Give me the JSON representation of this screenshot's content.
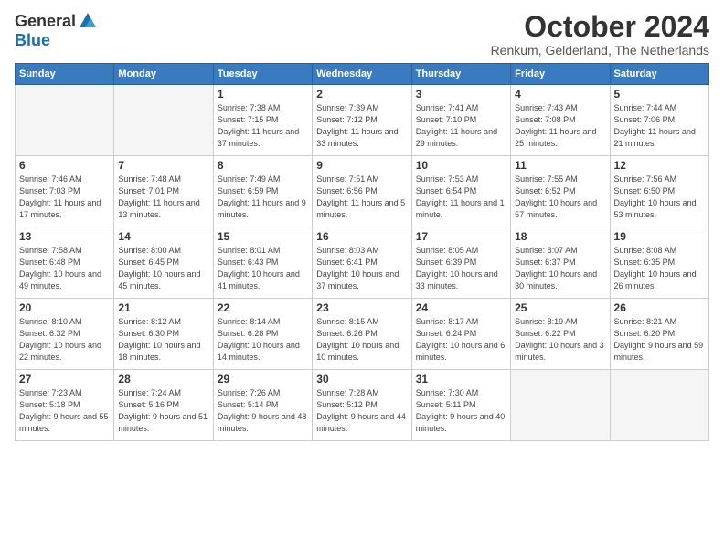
{
  "logo": {
    "general": "General",
    "blue": "Blue"
  },
  "title": "October 2024",
  "location": "Renkum, Gelderland, The Netherlands",
  "days_of_week": [
    "Sunday",
    "Monday",
    "Tuesday",
    "Wednesday",
    "Thursday",
    "Friday",
    "Saturday"
  ],
  "weeks": [
    [
      {
        "day": "",
        "empty": true
      },
      {
        "day": "",
        "empty": true
      },
      {
        "day": "1",
        "sunrise": "Sunrise: 7:38 AM",
        "sunset": "Sunset: 7:15 PM",
        "daylight": "Daylight: 11 hours and 37 minutes."
      },
      {
        "day": "2",
        "sunrise": "Sunrise: 7:39 AM",
        "sunset": "Sunset: 7:12 PM",
        "daylight": "Daylight: 11 hours and 33 minutes."
      },
      {
        "day": "3",
        "sunrise": "Sunrise: 7:41 AM",
        "sunset": "Sunset: 7:10 PM",
        "daylight": "Daylight: 11 hours and 29 minutes."
      },
      {
        "day": "4",
        "sunrise": "Sunrise: 7:43 AM",
        "sunset": "Sunset: 7:08 PM",
        "daylight": "Daylight: 11 hours and 25 minutes."
      },
      {
        "day": "5",
        "sunrise": "Sunrise: 7:44 AM",
        "sunset": "Sunset: 7:06 PM",
        "daylight": "Daylight: 11 hours and 21 minutes."
      }
    ],
    [
      {
        "day": "6",
        "sunrise": "Sunrise: 7:46 AM",
        "sunset": "Sunset: 7:03 PM",
        "daylight": "Daylight: 11 hours and 17 minutes."
      },
      {
        "day": "7",
        "sunrise": "Sunrise: 7:48 AM",
        "sunset": "Sunset: 7:01 PM",
        "daylight": "Daylight: 11 hours and 13 minutes."
      },
      {
        "day": "8",
        "sunrise": "Sunrise: 7:49 AM",
        "sunset": "Sunset: 6:59 PM",
        "daylight": "Daylight: 11 hours and 9 minutes."
      },
      {
        "day": "9",
        "sunrise": "Sunrise: 7:51 AM",
        "sunset": "Sunset: 6:56 PM",
        "daylight": "Daylight: 11 hours and 5 minutes."
      },
      {
        "day": "10",
        "sunrise": "Sunrise: 7:53 AM",
        "sunset": "Sunset: 6:54 PM",
        "daylight": "Daylight: 11 hours and 1 minute."
      },
      {
        "day": "11",
        "sunrise": "Sunrise: 7:55 AM",
        "sunset": "Sunset: 6:52 PM",
        "daylight": "Daylight: 10 hours and 57 minutes."
      },
      {
        "day": "12",
        "sunrise": "Sunrise: 7:56 AM",
        "sunset": "Sunset: 6:50 PM",
        "daylight": "Daylight: 10 hours and 53 minutes."
      }
    ],
    [
      {
        "day": "13",
        "sunrise": "Sunrise: 7:58 AM",
        "sunset": "Sunset: 6:48 PM",
        "daylight": "Daylight: 10 hours and 49 minutes."
      },
      {
        "day": "14",
        "sunrise": "Sunrise: 8:00 AM",
        "sunset": "Sunset: 6:45 PM",
        "daylight": "Daylight: 10 hours and 45 minutes."
      },
      {
        "day": "15",
        "sunrise": "Sunrise: 8:01 AM",
        "sunset": "Sunset: 6:43 PM",
        "daylight": "Daylight: 10 hours and 41 minutes."
      },
      {
        "day": "16",
        "sunrise": "Sunrise: 8:03 AM",
        "sunset": "Sunset: 6:41 PM",
        "daylight": "Daylight: 10 hours and 37 minutes."
      },
      {
        "day": "17",
        "sunrise": "Sunrise: 8:05 AM",
        "sunset": "Sunset: 6:39 PM",
        "daylight": "Daylight: 10 hours and 33 minutes."
      },
      {
        "day": "18",
        "sunrise": "Sunrise: 8:07 AM",
        "sunset": "Sunset: 6:37 PM",
        "daylight": "Daylight: 10 hours and 30 minutes."
      },
      {
        "day": "19",
        "sunrise": "Sunrise: 8:08 AM",
        "sunset": "Sunset: 6:35 PM",
        "daylight": "Daylight: 10 hours and 26 minutes."
      }
    ],
    [
      {
        "day": "20",
        "sunrise": "Sunrise: 8:10 AM",
        "sunset": "Sunset: 6:32 PM",
        "daylight": "Daylight: 10 hours and 22 minutes."
      },
      {
        "day": "21",
        "sunrise": "Sunrise: 8:12 AM",
        "sunset": "Sunset: 6:30 PM",
        "daylight": "Daylight: 10 hours and 18 minutes."
      },
      {
        "day": "22",
        "sunrise": "Sunrise: 8:14 AM",
        "sunset": "Sunset: 6:28 PM",
        "daylight": "Daylight: 10 hours and 14 minutes."
      },
      {
        "day": "23",
        "sunrise": "Sunrise: 8:15 AM",
        "sunset": "Sunset: 6:26 PM",
        "daylight": "Daylight: 10 hours and 10 minutes."
      },
      {
        "day": "24",
        "sunrise": "Sunrise: 8:17 AM",
        "sunset": "Sunset: 6:24 PM",
        "daylight": "Daylight: 10 hours and 6 minutes."
      },
      {
        "day": "25",
        "sunrise": "Sunrise: 8:19 AM",
        "sunset": "Sunset: 6:22 PM",
        "daylight": "Daylight: 10 hours and 3 minutes."
      },
      {
        "day": "26",
        "sunrise": "Sunrise: 8:21 AM",
        "sunset": "Sunset: 6:20 PM",
        "daylight": "Daylight: 9 hours and 59 minutes."
      }
    ],
    [
      {
        "day": "27",
        "sunrise": "Sunrise: 7:23 AM",
        "sunset": "Sunset: 5:18 PM",
        "daylight": "Daylight: 9 hours and 55 minutes."
      },
      {
        "day": "28",
        "sunrise": "Sunrise: 7:24 AM",
        "sunset": "Sunset: 5:16 PM",
        "daylight": "Daylight: 9 hours and 51 minutes."
      },
      {
        "day": "29",
        "sunrise": "Sunrise: 7:26 AM",
        "sunset": "Sunset: 5:14 PM",
        "daylight": "Daylight: 9 hours and 48 minutes."
      },
      {
        "day": "30",
        "sunrise": "Sunrise: 7:28 AM",
        "sunset": "Sunset: 5:12 PM",
        "daylight": "Daylight: 9 hours and 44 minutes."
      },
      {
        "day": "31",
        "sunrise": "Sunrise: 7:30 AM",
        "sunset": "Sunset: 5:11 PM",
        "daylight": "Daylight: 9 hours and 40 minutes."
      },
      {
        "day": "",
        "empty": true
      },
      {
        "day": "",
        "empty": true
      }
    ]
  ]
}
